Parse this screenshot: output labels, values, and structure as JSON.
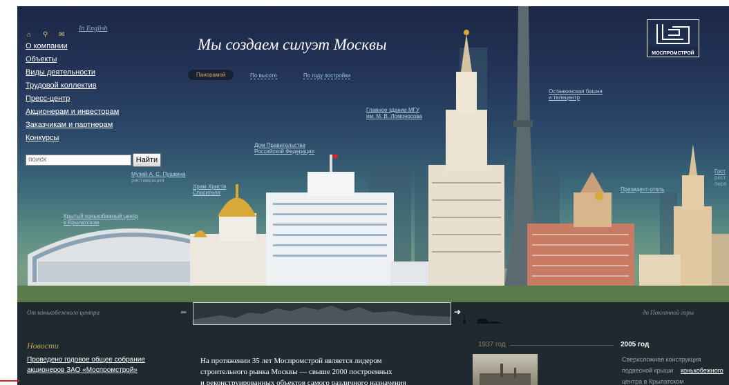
{
  "header": {
    "title": "Мы создаем силуэт Москвы",
    "english_link": "In English",
    "icons": [
      "home-icon",
      "search-icon",
      "mail-icon"
    ]
  },
  "nav": {
    "items": [
      "О компании",
      "Объекты",
      "Виды деятельности",
      "Трудовой коллектив",
      "Пресс-центр",
      "Акционерам и инвесторам",
      "Заказчикам и партнерам",
      "Конкурсы"
    ]
  },
  "search": {
    "placeholder": "поиск",
    "button": "Найти"
  },
  "view_tabs": [
    "Панорамой",
    "По высоте",
    "По году постройки"
  ],
  "logo": {
    "text": "МОСПРОМСТРОЙ"
  },
  "building_labels": {
    "krylatskoe": [
      "Крытый конькобежный центр",
      "в Крылатском"
    ],
    "pushkin": [
      "Музей А. С. Пушкина",
      "реставрация"
    ],
    "christ": [
      "Храм Христа",
      "Спасителя"
    ],
    "government": [
      "Дом Правительства",
      "Российской Федерации"
    ],
    "mgu": [
      "Главное здание МГУ",
      "им. М. В. Ломоносова"
    ],
    "ostankino": [
      "Останкинская башня",
      "и телецентр"
    ],
    "president": [
      "Президент-отель"
    ],
    "hotel": [
      "Гост",
      "рест",
      "пере"
    ]
  },
  "slider": {
    "left_label": "От конькобежного центра",
    "right_label": "до Поклонной горы"
  },
  "news": {
    "heading": "Новости",
    "items": [
      "Проведено годовое общее собрание",
      "акционеров ЗАО «Моспромстрой»"
    ]
  },
  "intro": {
    "lines": [
      "На протяжении 35 лет Моспромстрой является лидером",
      "строительного рынка Москвы — свыше 2000 построенных",
      "и реконструированных объектов самого различного назначения"
    ]
  },
  "timeline": {
    "year_left": "1937 год",
    "year_right": "2005 год",
    "right_text": [
      "Сверхсложная конструкция",
      "подвесной крыши",
      "конькобежного",
      "центра в Крылатском"
    ]
  },
  "colors": {
    "accent_gold": "#c0a25a",
    "sky_dark": "#1c2746",
    "footer_bg": "#1f2a30"
  }
}
